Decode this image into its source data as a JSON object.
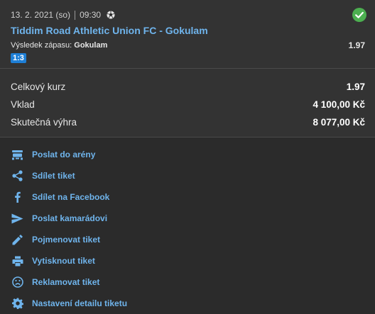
{
  "bet": {
    "date": "13. 2. 2021 (so)",
    "time": "09:30",
    "match": "Tiddim Road Athletic Union FC - Gokulam",
    "result_label": "Výsledek zápasu:",
    "result_pick": "Gokulam",
    "odd": "1.97",
    "score": "1:3",
    "status_color": "#4caf50"
  },
  "summary": {
    "total_odds_label": "Celkový kurz",
    "total_odds_value": "1.97",
    "stake_label": "Vklad",
    "stake_value": "4 100,00 Kč",
    "win_label": "Skutečná výhra",
    "win_value": "8 077,00 Kč"
  },
  "actions": [
    {
      "label": "Poslat do arény",
      "icon": "arena-icon"
    },
    {
      "label": "Sdílet tiket",
      "icon": "share-icon"
    },
    {
      "label": "Sdílet na Facebook",
      "icon": "facebook-icon"
    },
    {
      "label": "Poslat kamarádovi",
      "icon": "send-icon"
    },
    {
      "label": "Pojmenovat tiket",
      "icon": "pencil-icon"
    },
    {
      "label": "Vytisknout tiket",
      "icon": "print-icon"
    },
    {
      "label": "Reklamovat tiket",
      "icon": "sad-face-icon"
    },
    {
      "label": "Nastavení detailu tiketu",
      "icon": "gear-icon"
    }
  ]
}
